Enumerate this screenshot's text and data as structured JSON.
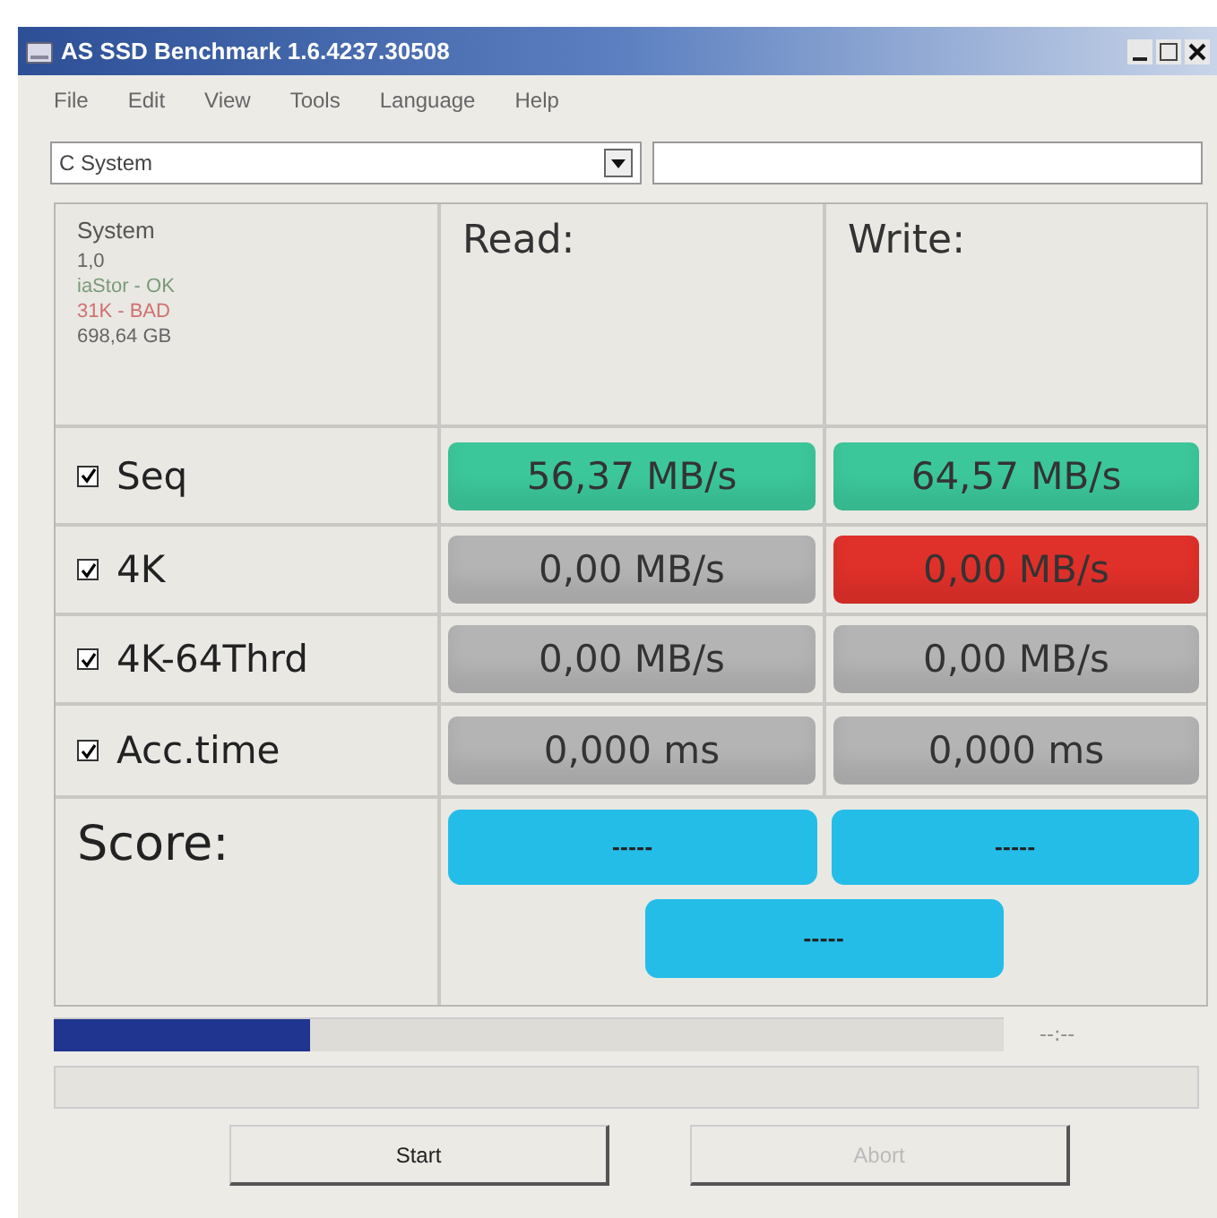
{
  "window": {
    "title": "AS SSD Benchmark 1.6.4237.30508"
  },
  "menu": [
    "File",
    "Edit",
    "View",
    "Tools",
    "Language",
    "Help"
  ],
  "drive_select": {
    "value": "C System"
  },
  "drive_info": [
    {
      "text": "System",
      "kind": "name"
    },
    {
      "text": "1,0",
      "kind": "plain"
    },
    {
      "text": "iaStor - OK",
      "kind": "ok"
    },
    {
      "text": "31K - BAD",
      "kind": "bad"
    },
    {
      "text": "698,64 GB",
      "kind": "plain"
    }
  ],
  "columns": [
    "Read:",
    "Write:"
  ],
  "tests": [
    {
      "label": "Seq",
      "checked": true,
      "read": {
        "value": "56,37 MB/s",
        "color": "#3cc79a"
      },
      "write": {
        "value": "64,57 MB/s",
        "color": "#3cc79a"
      }
    },
    {
      "label": "4K",
      "checked": true,
      "read": {
        "value": "0,00 MB/s",
        "color": "#b4b4b4"
      },
      "write": {
        "value": "0,00 MB/s",
        "color": "#e0302a"
      }
    },
    {
      "label": "4K-64Thrd",
      "checked": true,
      "read": {
        "value": "0,00 MB/s",
        "color": "#b4b4b4"
      },
      "write": {
        "value": "0,00 MB/s",
        "color": "#b4b4b4"
      }
    },
    {
      "label": "Acc.time",
      "checked": true,
      "read": {
        "value": "0,000 ms",
        "color": "#b4b4b4"
      },
      "write": {
        "value": "0,000 ms",
        "color": "#b4b4b4"
      }
    }
  ],
  "score": {
    "label": "Score:",
    "read": "-----",
    "write": "-----",
    "total": "-----"
  },
  "progress": {
    "level": 0.27,
    "time": "--:--"
  },
  "buttons": [
    {
      "label": "Start",
      "disabled": false
    },
    {
      "label": "Abort",
      "disabled": true
    }
  ]
}
